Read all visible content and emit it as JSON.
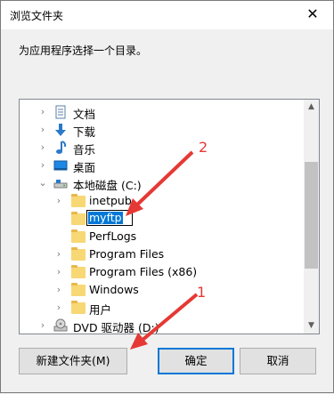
{
  "window": {
    "title": "浏览文件夹",
    "close_glyph": "✕"
  },
  "prompt": "为应用程序选择一个目录。",
  "tree": {
    "items": [
      {
        "label": "文档",
        "icon": "documents-icon",
        "expander": "›"
      },
      {
        "label": "下载",
        "icon": "download-icon",
        "expander": "›"
      },
      {
        "label": "音乐",
        "icon": "music-icon",
        "expander": "›"
      },
      {
        "label": "桌面",
        "icon": "desktop-icon",
        "expander": "›"
      },
      {
        "label": "本地磁盘 (C:)",
        "icon": "drive-icon",
        "expander": "⌄"
      },
      {
        "label": "inetpub",
        "icon": "folder-icon",
        "expander": "›"
      },
      {
        "label": "myftp",
        "icon": "folder-icon",
        "expander": "",
        "editing": true
      },
      {
        "label": "PerfLogs",
        "icon": "folder-icon",
        "expander": ""
      },
      {
        "label": "Program Files",
        "icon": "folder-icon",
        "expander": "›"
      },
      {
        "label": "Program Files (x86)",
        "icon": "folder-icon",
        "expander": "›"
      },
      {
        "label": "Windows",
        "icon": "folder-icon",
        "expander": "›"
      },
      {
        "label": "用户",
        "icon": "folder-icon",
        "expander": "›"
      },
      {
        "label": "DVD 驱动器 (D:)",
        "icon": "dvd-drive-icon",
        "expander": "›"
      }
    ]
  },
  "buttons": {
    "new_folder": "新建文件夹(M)",
    "ok": "确定",
    "cancel": "取消"
  },
  "annotations": {
    "one": "1",
    "two": "2"
  },
  "colors": {
    "accent": "#0078d7",
    "annotation": "#e53935"
  }
}
